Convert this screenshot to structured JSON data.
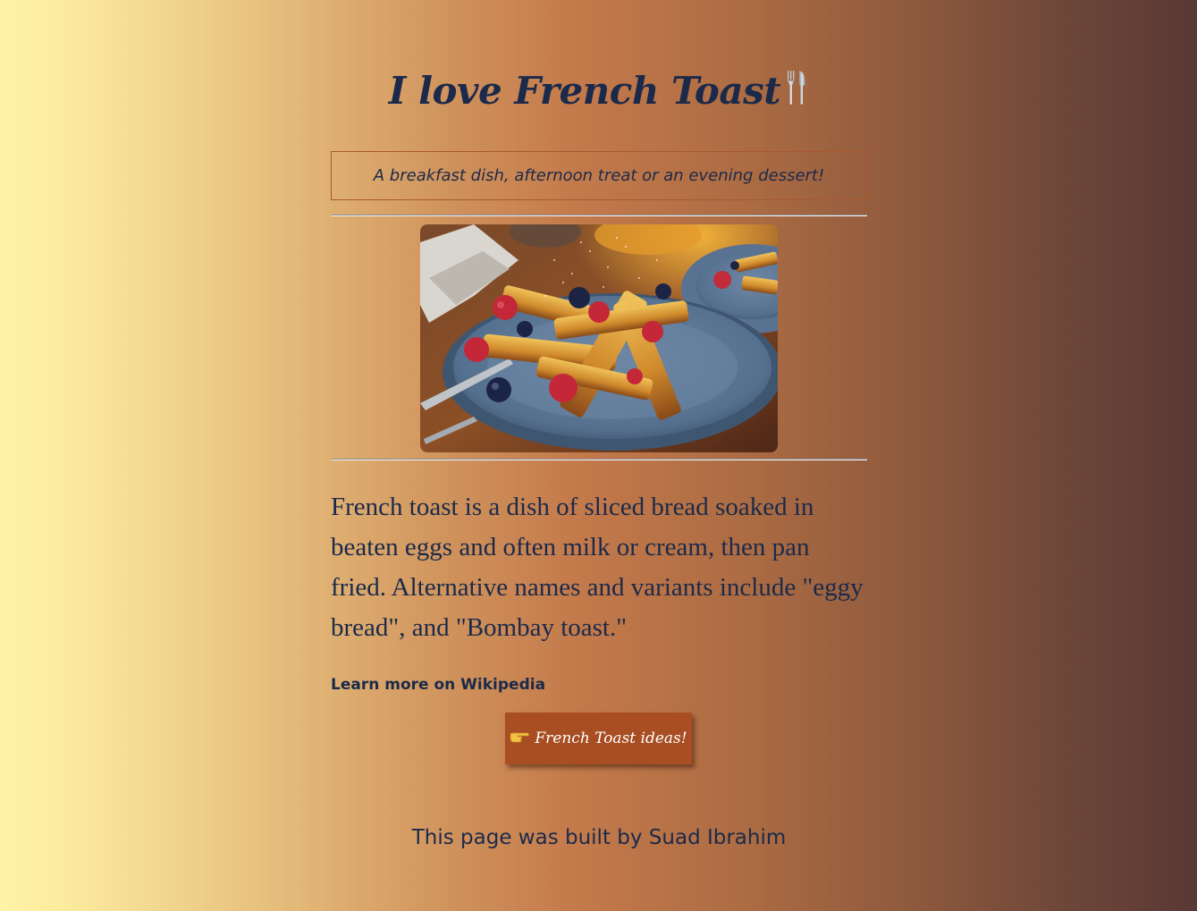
{
  "header": {
    "title": "I love French Toast",
    "title_icon": "fork-and-knife-icon"
  },
  "tagline": "A breakfast dish, afternoon treat or an evening dessert!",
  "hero_image": {
    "description_icon": "french-toast-photo"
  },
  "main": {
    "description": "French toast is a dish of sliced bread soaked in beaten eggs and often milk or cream, then pan fried. Alternative names and variants include \"eggy bread\", and \"Bombay toast.\"",
    "link_label": "Learn more on Wikipedia",
    "button_label": "French Toast ideas!",
    "button_icon": "pointing-hand-icon"
  },
  "footer": {
    "credit": "This page was built by Suad Ibrahim"
  },
  "colors": {
    "text": "#1b2a4a",
    "button": "#a84e22",
    "tagline_border": "#a8582e"
  }
}
